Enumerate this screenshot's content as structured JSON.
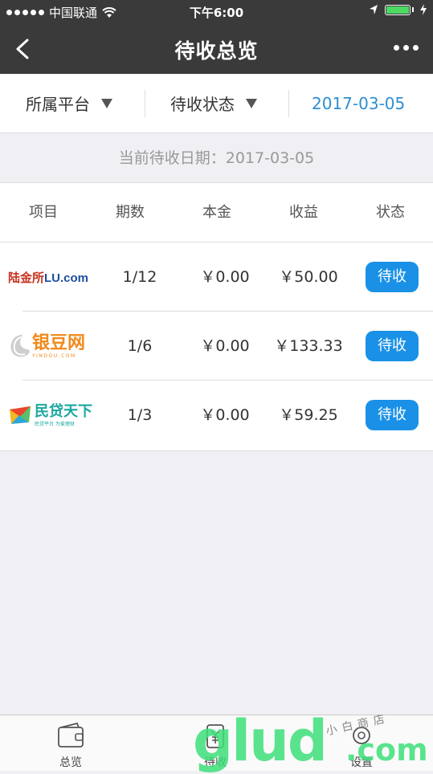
{
  "status_bar": {
    "carrier": "中国联通",
    "time": "下午6:00"
  },
  "nav": {
    "title": "待收总览"
  },
  "filters": {
    "platform": "所属平台",
    "status": "待收状态",
    "date": "2017-03-05"
  },
  "current_date": {
    "label": "当前待收日期：",
    "value": "2017-03-05"
  },
  "table": {
    "headers": {
      "project": "项目",
      "period": "期数",
      "principal": "本金",
      "income": "收益",
      "status": "状态"
    },
    "rows": [
      {
        "logo": {
          "zh": "陆金所",
          "en": "LU.com"
        },
        "logo_icon": "lufax-logo",
        "period": "1/12",
        "principal": "￥0.00",
        "income": "￥50.00",
        "status": "待收"
      },
      {
        "logo": {
          "zh": "银豆网",
          "en": "YINDOU.COM"
        },
        "logo_icon": "yindou-logo",
        "period": "1/6",
        "principal": "￥0.00",
        "income": "￥133.33",
        "status": "待收"
      },
      {
        "logo": {
          "zh": "民贷天下",
          "en": "民贷平台 为爱理财"
        },
        "logo_icon": "mindai-logo",
        "period": "1/3",
        "principal": "￥0.00",
        "income": "￥59.25",
        "status": "待收"
      }
    ]
  },
  "tabbar": {
    "overview": "总览",
    "pending": "待收",
    "settings": "设置"
  },
  "watermark": {
    "main": "glud",
    "suffix": ".com",
    "shop": "小白商店"
  },
  "colors": {
    "nav_bg": "#3b3a3a",
    "accent": "#1a91e6",
    "date_link": "#2d8fd3",
    "page_bg": "#efeff4"
  }
}
